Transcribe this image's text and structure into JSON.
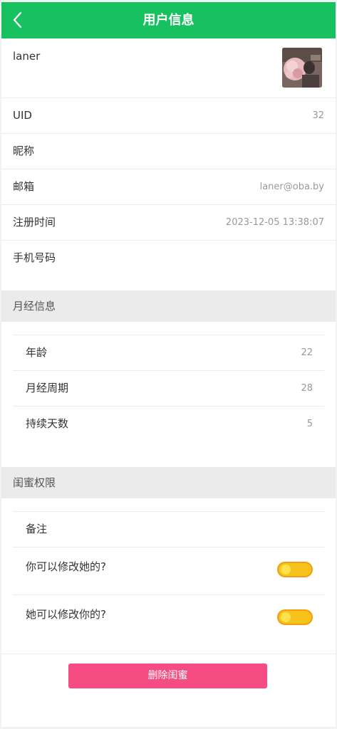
{
  "navbar": {
    "title": "用户信息",
    "back_icon": "chevron-left-icon",
    "color": "#17c15f"
  },
  "profile": {
    "name": "laner",
    "avatar": "avatar-image"
  },
  "info_rows": [
    {
      "label": "UID",
      "value": "32"
    },
    {
      "label": "昵称",
      "value": ""
    },
    {
      "label": "邮箱",
      "value": "laner@oba.by"
    },
    {
      "label": "注册时间",
      "value": "2023-12-05 13:38:07"
    },
    {
      "label": "手机号码",
      "value": ""
    }
  ],
  "period_section": {
    "title": "月经信息",
    "rows": [
      {
        "label": "年龄",
        "value": "22"
      },
      {
        "label": "月经周期",
        "value": "28"
      },
      {
        "label": "持续天数",
        "value": "5"
      }
    ]
  },
  "permission_section": {
    "title": "闺蜜权限",
    "note_label": "备注",
    "toggles": [
      {
        "label": "你可以修改她的?",
        "enabled": true
      },
      {
        "label": "她可以修改你的?",
        "enabled": true
      }
    ],
    "toggle_color": "#f7c21a"
  },
  "actions": {
    "delete_label": "删除闺蜜",
    "delete_color": "#f54c83"
  }
}
